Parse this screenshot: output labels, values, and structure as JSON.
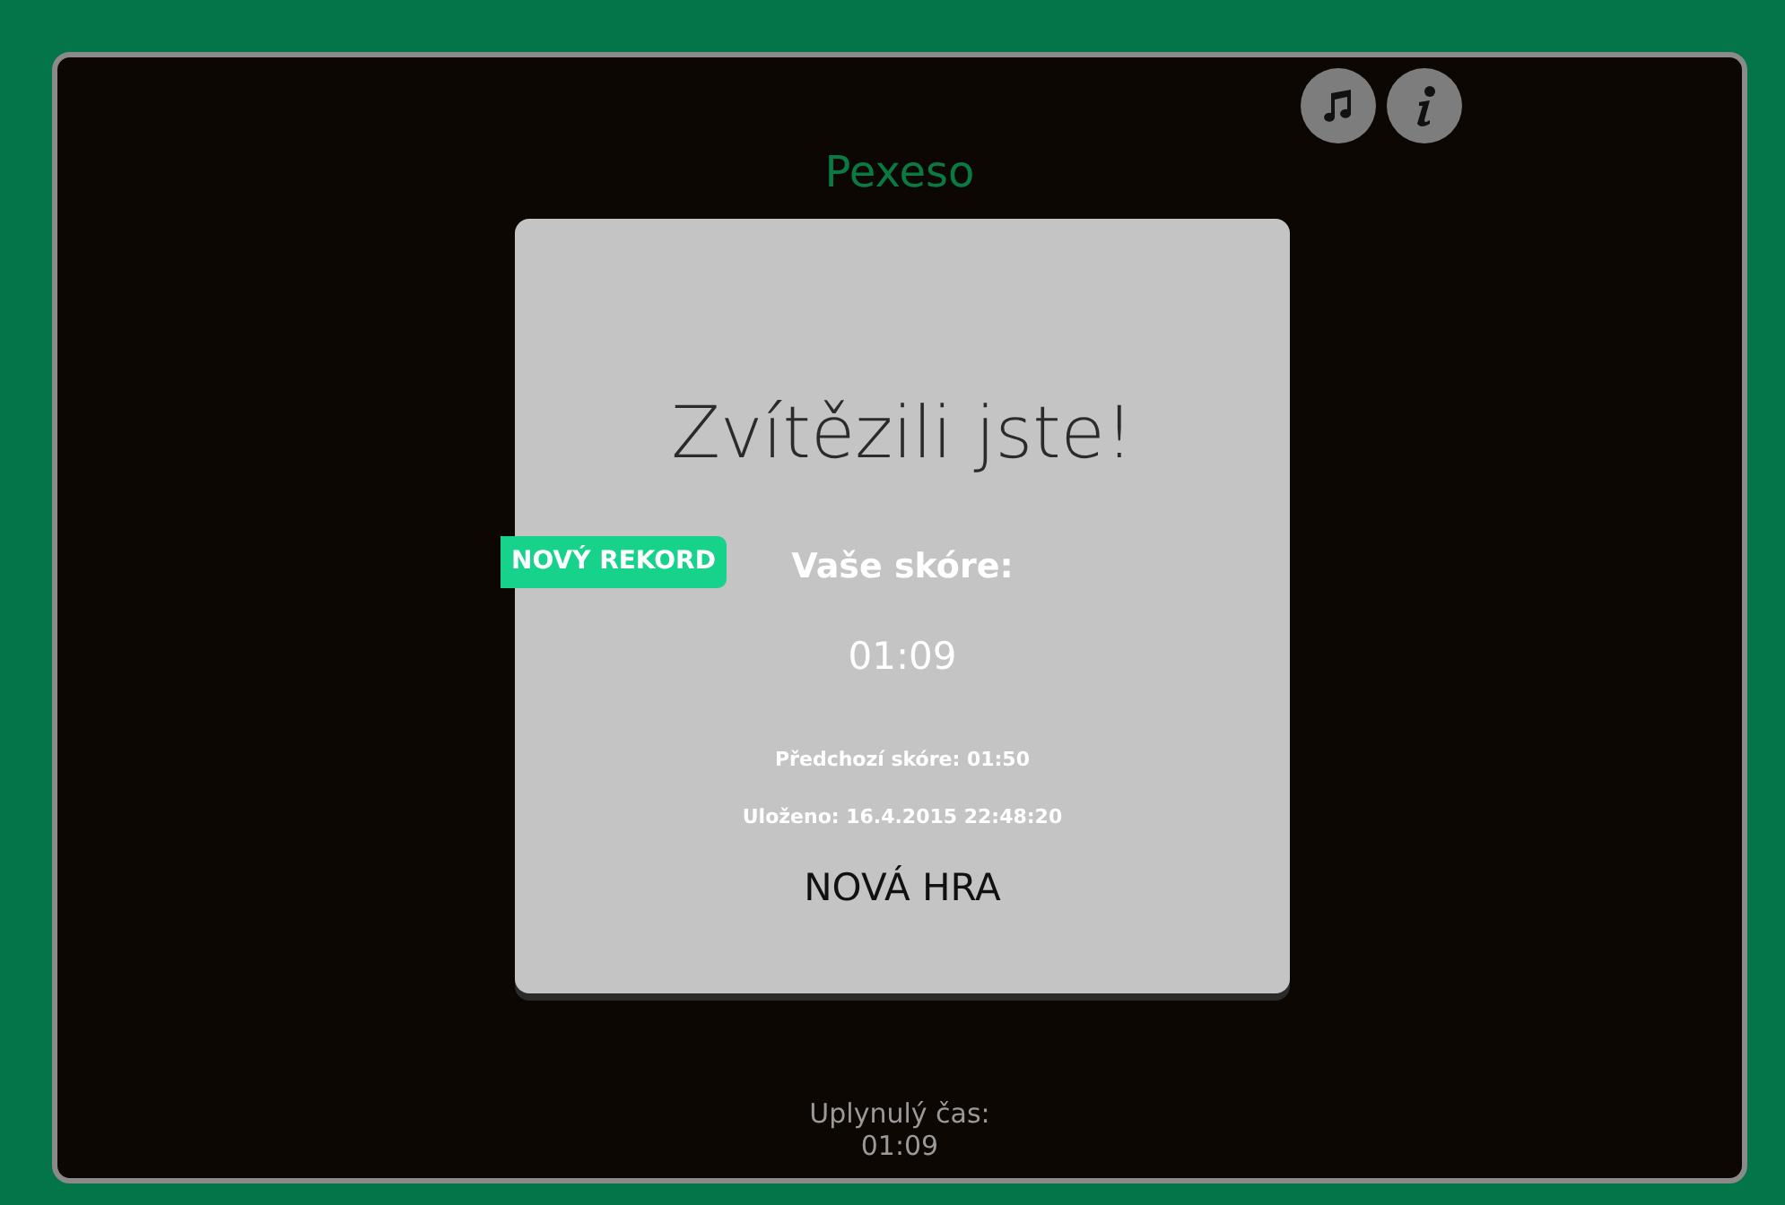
{
  "title": "Pexeso",
  "dialog": {
    "heading": "Zvítězili jste!",
    "badge": "NOVÝ REKORD",
    "score_label": "Vaše skóre:",
    "score": "01:09",
    "previous": "Předchozí skóre: 01:50",
    "saved": "Uloženo: 16.4.2015 22:48:20",
    "button": "NOVÁ HRA"
  },
  "footer": {
    "elapsed_label": "Uplynulý čas:",
    "elapsed": "01:09"
  }
}
